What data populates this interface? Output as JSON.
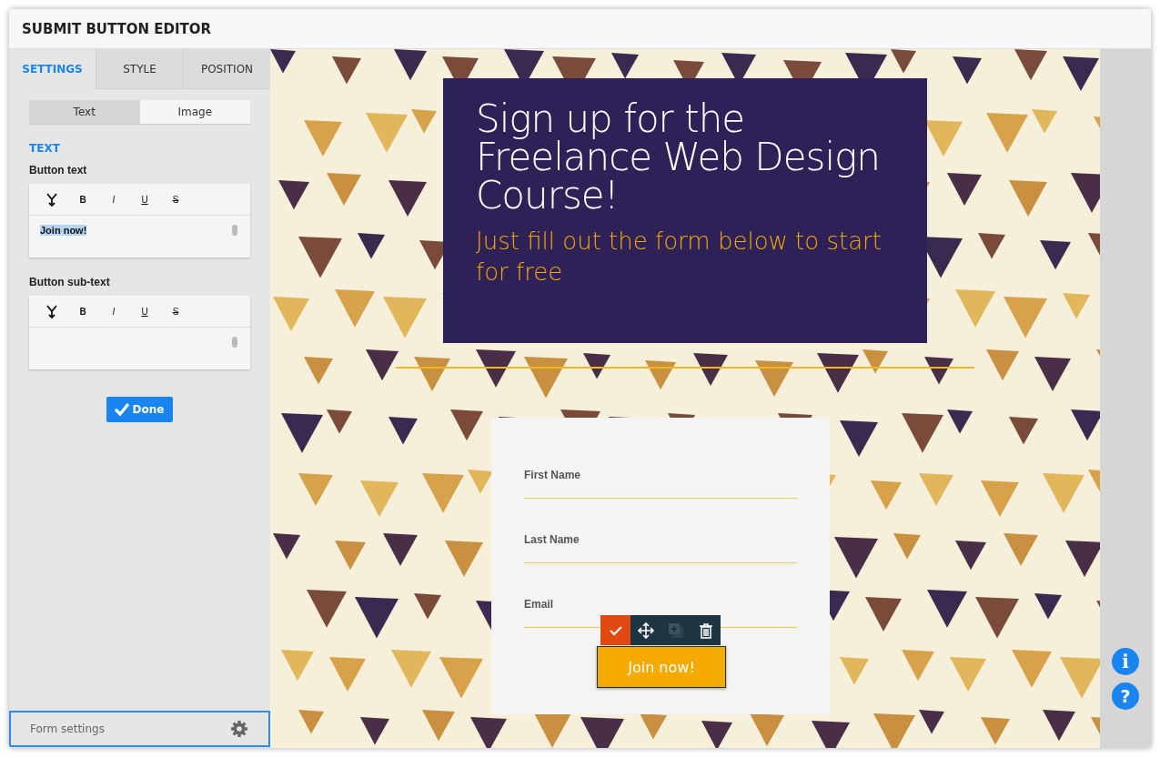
{
  "window": {
    "title": "SUBMIT BUTTON EDITOR"
  },
  "tabs": [
    {
      "label": "SETTINGS",
      "selected": true
    },
    {
      "label": "STYLE",
      "selected": false
    },
    {
      "label": "POSITION",
      "selected": false
    }
  ],
  "mode_toggle": [
    {
      "label": "Text",
      "selected": true
    },
    {
      "label": "Image",
      "selected": false
    }
  ],
  "section_heading": "TEXT",
  "editors": [
    {
      "label": "Button text",
      "value": "Join now!",
      "text_selected": true,
      "tools": [
        {
          "label": "B",
          "kind": "bold"
        },
        {
          "label": "I",
          "kind": "italic"
        },
        {
          "label": "U",
          "kind": "underline"
        },
        {
          "label": "S",
          "kind": "strike"
        }
      ]
    },
    {
      "label": "Button sub-text",
      "tools": [
        {
          "label": "B",
          "kind": "bold"
        },
        {
          "label": "I",
          "kind": "italic"
        },
        {
          "label": "U",
          "kind": "underline"
        },
        {
          "label": "S",
          "kind": "strike"
        }
      ]
    }
  ],
  "done_button": "Done",
  "form_settings": "Form settings",
  "headline": {
    "title": "Sign up for the Freelance Web Design Course!",
    "subtitle": "Just fill out the form below to start for free"
  },
  "form": {
    "fields": [
      {
        "label": "First Name"
      },
      {
        "label": "Last Name"
      },
      {
        "label": "Email"
      }
    ],
    "submit": "Join now!"
  },
  "button_toolbar": [
    {
      "kind": "confirm",
      "selected": true,
      "disabled": false
    },
    {
      "kind": "move",
      "selected": false,
      "disabled": false
    },
    {
      "kind": "duplicate",
      "selected": false,
      "disabled": true
    },
    {
      "kind": "delete",
      "selected": false,
      "disabled": false
    }
  ],
  "side_buttons": [
    "i",
    "?"
  ]
}
